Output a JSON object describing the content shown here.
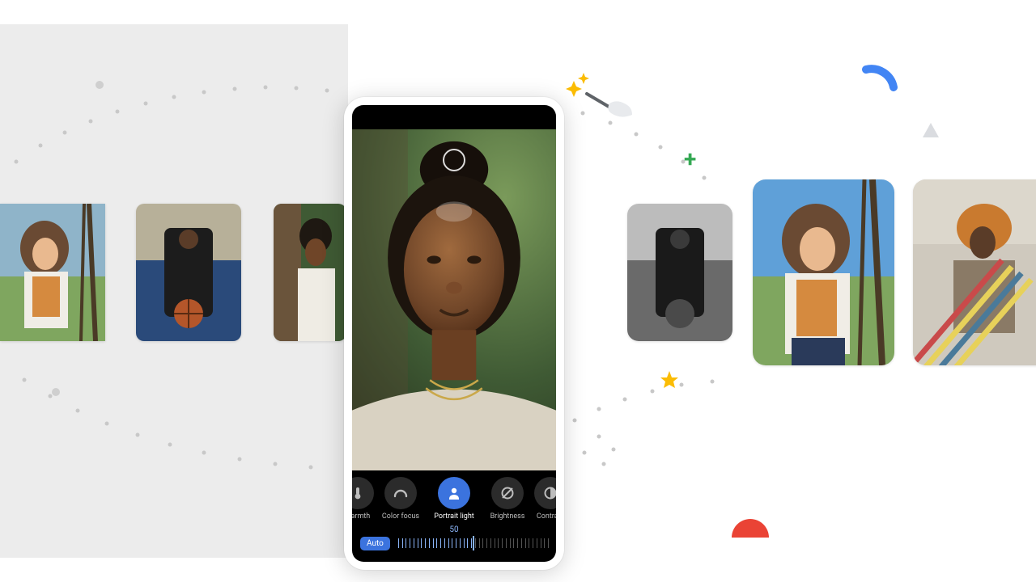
{
  "editor": {
    "tools": [
      {
        "id": "warmth",
        "label": "warmth",
        "icon": "thermometer"
      },
      {
        "id": "color_focus",
        "label": "Color focus",
        "icon": "arc"
      },
      {
        "id": "portrait_light",
        "label": "Portrait light",
        "icon": "person",
        "active": true
      },
      {
        "id": "brightness",
        "label": "Brightness",
        "icon": "sun-slash"
      },
      {
        "id": "contrast",
        "label": "Contrast",
        "icon": "half-circle"
      }
    ],
    "slider": {
      "value": "50",
      "auto_label": "Auto",
      "position": 0.5,
      "fill": 0.5
    }
  },
  "thumbnails": {
    "left": [
      {
        "id": "girl-swing",
        "desc": "Young woman on swing, orange shirt, white cardigan"
      },
      {
        "id": "bball",
        "desc": "Man crouching with basketball on blue court"
      },
      {
        "id": "woman-tree",
        "desc": "Woman with updo in front of tree, white top"
      }
    ],
    "right": [
      {
        "id": "bball-bw",
        "desc": "Black and white basketball portrait"
      },
      {
        "id": "girl-swing-2",
        "desc": "Young woman on swing, blue sky"
      },
      {
        "id": "hammock",
        "desc": "Person with orange afro on striped hammock"
      }
    ]
  },
  "hero_photo": {
    "desc": "Portrait of woman with natural hair updo, gold necklaces, cream top, green foliage background"
  },
  "confetti": {
    "items": [
      "blue-arc",
      "green-plus",
      "yellow-star",
      "red-semicircle",
      "grey-triangle",
      "magic-wand-sparkle"
    ]
  }
}
